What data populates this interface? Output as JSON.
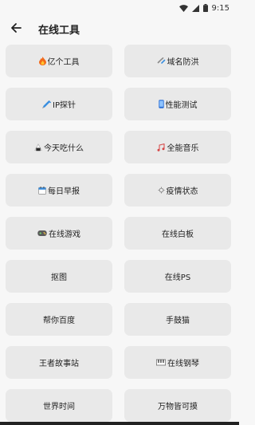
{
  "status_bar": {
    "time": "9:15"
  },
  "header": {
    "title": "在线工具"
  },
  "tools": [
    {
      "label": "亿个工具",
      "icon": "fire-icon"
    },
    {
      "label": "域名防洪",
      "icon": "link-icon"
    },
    {
      "label": "IP探针",
      "icon": "syringe-icon"
    },
    {
      "label": "性能测试",
      "icon": "phone-icon"
    },
    {
      "label": "今天吃什么",
      "icon": "rice-ball-icon"
    },
    {
      "label": "全能音乐",
      "icon": "music-notes-icon"
    },
    {
      "label": "每日早报",
      "icon": "calendar-icon"
    },
    {
      "label": "疫情状态",
      "icon": "virus-icon"
    },
    {
      "label": "在线游戏",
      "icon": "gamepad-icon"
    },
    {
      "label": "在线白板",
      "icon": ""
    },
    {
      "label": "抠图",
      "icon": ""
    },
    {
      "label": "在线PS",
      "icon": ""
    },
    {
      "label": "帮你百度",
      "icon": ""
    },
    {
      "label": "手鼓猫",
      "icon": ""
    },
    {
      "label": "王者故事站",
      "icon": ""
    },
    {
      "label": "在线钢琴",
      "icon": "piano-icon"
    },
    {
      "label": "世界时间",
      "icon": ""
    },
    {
      "label": "万物皆可摸",
      "icon": ""
    }
  ]
}
